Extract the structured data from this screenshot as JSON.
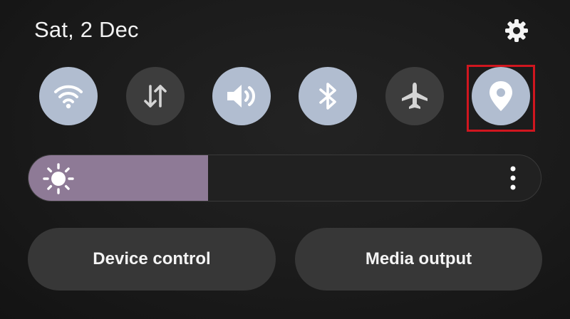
{
  "header": {
    "date": "Sat, 2 Dec",
    "settings_icon": "gear-icon"
  },
  "quick_toggles": [
    {
      "name": "Wi-Fi",
      "icon": "wifi-icon",
      "state": "on"
    },
    {
      "name": "Mobile data",
      "icon": "mobile-data-icon",
      "state": "off"
    },
    {
      "name": "Sound",
      "icon": "sound-icon",
      "state": "on"
    },
    {
      "name": "Bluetooth",
      "icon": "bluetooth-icon",
      "state": "on"
    },
    {
      "name": "Airplane mode",
      "icon": "airplane-icon",
      "state": "off"
    },
    {
      "name": "Location",
      "icon": "location-icon",
      "state": "on",
      "highlighted": true
    }
  ],
  "brightness": {
    "level": 0.35,
    "icon": "sun-icon",
    "menu_icon": "more-vertical-icon"
  },
  "buttons": {
    "device_control": "Device control",
    "media_output": "Media output"
  },
  "colors": {
    "toggle_on": "#b1bdd0",
    "toggle_off": "#3d3d3d",
    "brightness_fill": "#8e7a96",
    "highlight_box": "#d0161f"
  }
}
